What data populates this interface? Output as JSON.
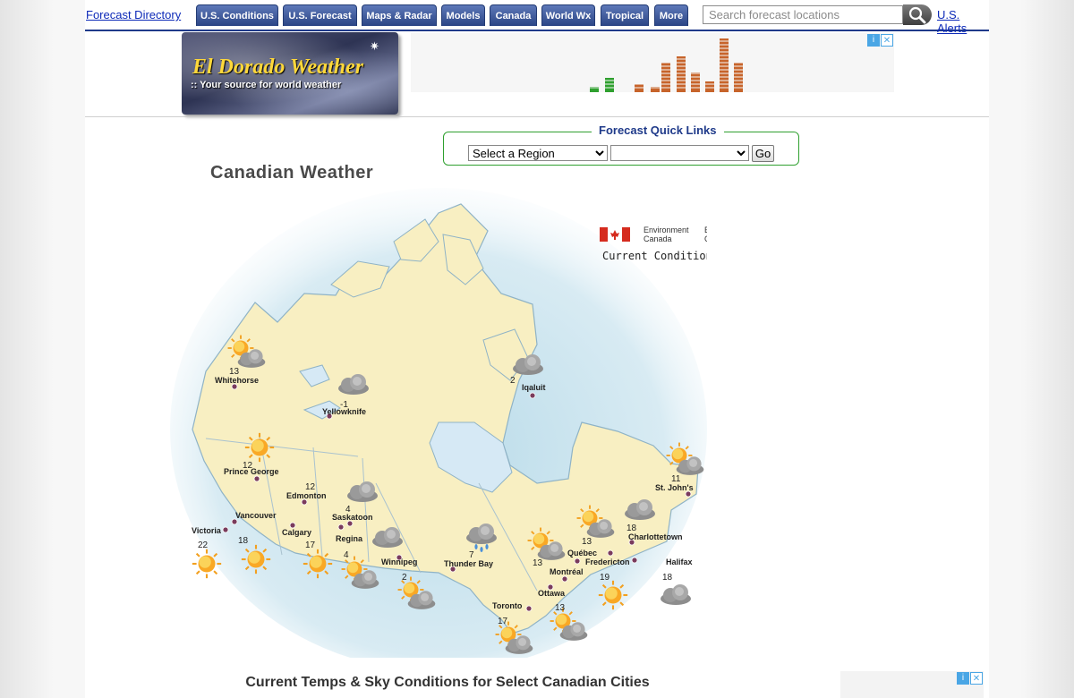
{
  "nav": {
    "directory_link": "Forecast Directory",
    "tabs": [
      {
        "label": "U.S. Conditions"
      },
      {
        "label": "U.S. Forecast"
      },
      {
        "label": "Maps & Radar"
      },
      {
        "label": "Models"
      },
      {
        "label": "Canada"
      },
      {
        "label": "World Wx"
      },
      {
        "label": "Tropical"
      },
      {
        "label": "More"
      }
    ],
    "search_placeholder": "Search forecast locations",
    "alerts_link": "U.S. Alerts"
  },
  "logo": {
    "title": "El Dorado Weather",
    "subtitle": ":: Your source for world weather"
  },
  "quick_links": {
    "title": "Forecast Quick Links",
    "region_select": "Select a Region",
    "sub_select": "",
    "go_button": "Go"
  },
  "page_title": "Canadian Weather",
  "map": {
    "agency_en": "Environment Canada",
    "agency_fr": "Environnement Canada",
    "map_label": "Current Conditions",
    "cities": [
      {
        "name": "Whitehorse",
        "temp": "13",
        "sky": "partly-cloudy-icon"
      },
      {
        "name": "Yellowknife",
        "temp": "-1",
        "sky": "cloudy-icon"
      },
      {
        "name": "Iqaluit",
        "temp": "2",
        "sky": "cloudy-icon"
      },
      {
        "name": "Prince George",
        "temp": "12",
        "sky": "sunny-icon"
      },
      {
        "name": "Edmonton",
        "temp": "12",
        "sky": "cloudy-icon"
      },
      {
        "name": "Vancouver",
        "temp": "18",
        "sky": "sunny-icon"
      },
      {
        "name": "Victoria",
        "temp": "22",
        "sky": "sunny-icon"
      },
      {
        "name": "Calgary",
        "temp": "17",
        "sky": "sunny-icon"
      },
      {
        "name": "Saskatoon",
        "temp": "4",
        "sky": "cloudy-icon"
      },
      {
        "name": "Regina",
        "temp": "4",
        "sky": "partly-cloudy-icon"
      },
      {
        "name": "Winnipeg",
        "temp": "2",
        "sky": "partly-cloudy-icon"
      },
      {
        "name": "Thunder Bay",
        "temp": "7",
        "sky": "rain-icon"
      },
      {
        "name": "Toronto",
        "temp": "17",
        "sky": "partly-cloudy-icon"
      },
      {
        "name": "Ottawa",
        "temp": "13",
        "sky": "partly-cloudy-icon"
      },
      {
        "name": "Montréal",
        "temp": "13",
        "sky": "partly-cloudy-icon"
      },
      {
        "name": "Québec",
        "temp": "13",
        "sky": "partly-cloudy-icon"
      },
      {
        "name": "Fredericton",
        "temp": "19",
        "sky": "sunny-icon"
      },
      {
        "name": "Charlottetown",
        "temp": "18",
        "sky": "cloudy-icon"
      },
      {
        "name": "Halifax",
        "temp": "18",
        "sky": "cloudy-icon"
      },
      {
        "name": "St. John's",
        "temp": "11",
        "sky": "partly-cloudy-icon"
      }
    ]
  },
  "footer_heading": "Current Temps & Sky Conditions for Select Canadian Cities",
  "colors": {
    "nav_tab": "#2b4585",
    "link": "#0d2ab8",
    "quick_links_border": "#2fa02f",
    "land": "#f8efc2",
    "water": "#d6e9f5"
  }
}
